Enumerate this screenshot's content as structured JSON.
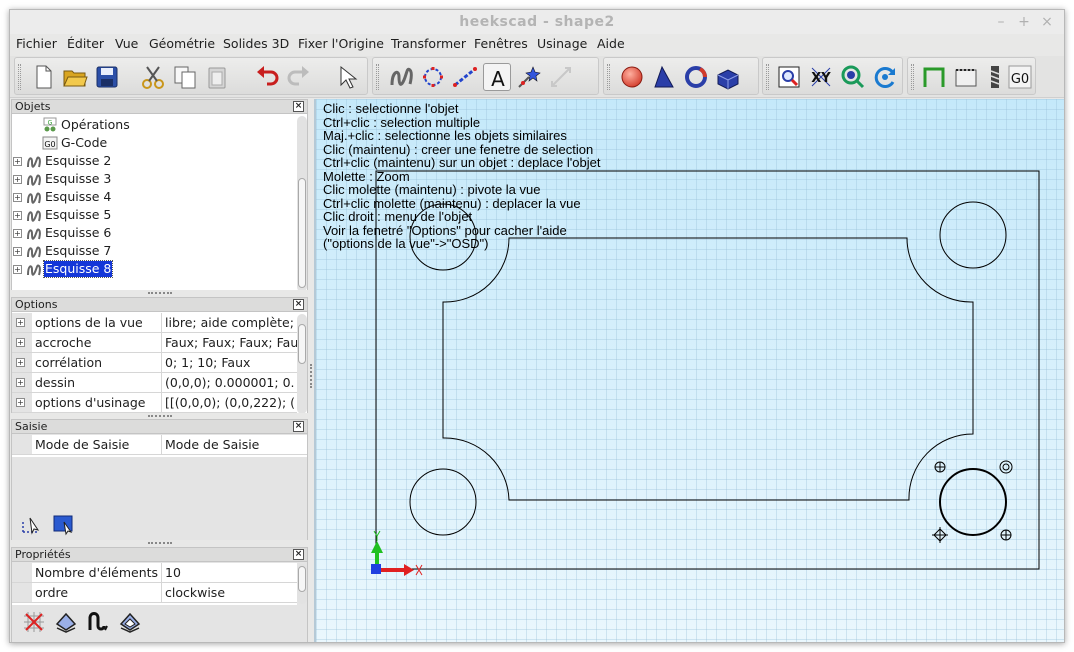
{
  "window": {
    "title": "heekscad - shape2",
    "controls": [
      "–",
      "+",
      "×"
    ]
  },
  "menubar": [
    "Fichier",
    "Éditer",
    "Vue",
    "Géométrie",
    "Solides 3D",
    "Fixer l'Origine",
    "Transformer",
    "Fenêtres",
    "Usinage",
    "Aide"
  ],
  "toolbar": {
    "groups": [
      {
        "name": "file-edit",
        "buttons": [
          "new-file-icon",
          "open-folder-icon",
          "save-icon",
          "cut-icon",
          "copy-icon",
          "paste-icon",
          "undo-icon",
          "redo-icon",
          "select-arrow-icon"
        ]
      },
      {
        "name": "sketch",
        "buttons": [
          "sketch-curve-icon",
          "circle-points-icon",
          "line-points-icon",
          "text-icon",
          "star-point-icon",
          "dimension-icon"
        ]
      },
      {
        "name": "solids",
        "buttons": [
          "sphere-icon",
          "cone-icon",
          "torus-icon",
          "box-icon"
        ]
      },
      {
        "name": "view",
        "buttons": [
          "zoom-window-icon",
          "view-xy-icon",
          "zoom-fit-icon",
          "rotate-view-icon"
        ]
      },
      {
        "name": "machining",
        "buttons": [
          "profile-op-icon",
          "pocket-op-icon",
          "drill-op-icon",
          "gcode-icon"
        ]
      }
    ],
    "text_button_label": "A",
    "view_xy_label": "XY",
    "gcode_label": "G0"
  },
  "objects_panel": {
    "title": "Objets",
    "items": [
      {
        "label": "Opérations",
        "indent": 2,
        "expander": false,
        "selected": false,
        "icon": "operations-icon"
      },
      {
        "label": "G-Code",
        "indent": 2,
        "expander": false,
        "selected": false,
        "icon": "gcode-doc-icon"
      },
      {
        "label": "Esquisse 2",
        "indent": 1,
        "expander": true,
        "selected": false,
        "icon": "sketch-icon"
      },
      {
        "label": "Esquisse 3",
        "indent": 1,
        "expander": true,
        "selected": false,
        "icon": "sketch-icon"
      },
      {
        "label": "Esquisse 4",
        "indent": 1,
        "expander": true,
        "selected": false,
        "icon": "sketch-icon"
      },
      {
        "label": "Esquisse 5",
        "indent": 1,
        "expander": true,
        "selected": false,
        "icon": "sketch-icon"
      },
      {
        "label": "Esquisse 6",
        "indent": 1,
        "expander": true,
        "selected": false,
        "icon": "sketch-icon"
      },
      {
        "label": "Esquisse 7",
        "indent": 1,
        "expander": true,
        "selected": false,
        "icon": "sketch-icon"
      },
      {
        "label": "Esquisse 8",
        "indent": 1,
        "expander": true,
        "selected": true,
        "icon": "sketch-icon"
      }
    ],
    "gcode_icon_label": "G0",
    "operations_icon_label": "G"
  },
  "options_panel": {
    "title": "Options",
    "rows": [
      {
        "name": "options de la vue",
        "value": "libre; aide complète;"
      },
      {
        "name": "accroche",
        "value": "Faux; Faux; Faux; Fau"
      },
      {
        "name": "corrélation",
        "value": "0; 1; 10; Faux"
      },
      {
        "name": "dessin",
        "value": "(0,0,0); 0.000001; 0."
      },
      {
        "name": "options d'usinage",
        "value": "[[(0,0,0); (0,0,222); ("
      }
    ]
  },
  "input_panel": {
    "title": "Saisie",
    "rows": [
      {
        "name": "Mode de Saisie",
        "value": "Mode de Saisie"
      }
    ],
    "tools": [
      "select-mode-icon",
      "window-select-icon"
    ]
  },
  "properties_panel": {
    "title": "Propriétés",
    "rows": [
      {
        "name": "Nombre d'éléments",
        "value": "10"
      },
      {
        "name": "ordre",
        "value": "clockwise"
      }
    ],
    "tools": [
      "grid-pattern-icon",
      "profile-tool-icon",
      "spline-tool-icon",
      "pocket-tool-icon"
    ]
  },
  "viewport": {
    "help_lines": [
      "Clic : selectionne l'objet",
      "Ctrl+clic : selection multiple",
      "Maj.+clic : selectionne les objets similaires",
      "Clic (maintenu) : creer une fenetre de selection",
      "Ctrl+clic (maintenu) sur un objet : deplace l'objet",
      "Molette : Zoom",
      "Clic molette (maintenu) : pivote la vue",
      "Ctrl+clic molette (maintenu) : deplacer la vue",
      "Clic droit : menu de l'objet",
      "Voir la fenetré \"Options\" pour cacher l'aide",
      "(\"options de la vue\"->\"OSD\")"
    ],
    "colors": {
      "background_top": "#c5e9fa",
      "background_bottom": "#eaf7fd",
      "x_axis": "#e02020",
      "y_axis": "#20c020",
      "z_axis": "#2040e0"
    }
  }
}
